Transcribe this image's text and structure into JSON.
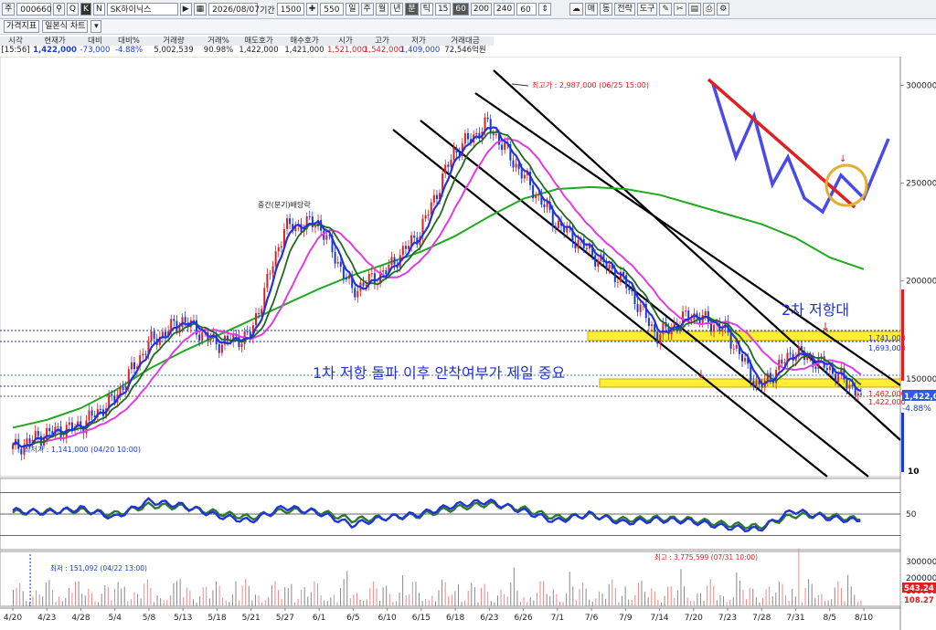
{
  "toolbar": {
    "type_label": "주",
    "code": "000660",
    "btn_q": "Q",
    "btn_k": "K",
    "btn_n": "N",
    "stock_name": "SK하이닉스",
    "date": "2026/08/07",
    "period_label": "기간",
    "period_value": "1500",
    "zoom_value": "550",
    "units": [
      "일",
      "주",
      "월",
      "년",
      "분",
      "틱"
    ],
    "minutes": [
      "15",
      "60",
      "200",
      "240",
      "60"
    ],
    "right_buttons": [
      "매",
      "동",
      "전략",
      "도구"
    ]
  },
  "subtoolbar": {
    "indicator_label": "가격지표",
    "chart_label": "일본식 차트"
  },
  "quote": {
    "headers": [
      "시각",
      "현재가",
      "대비",
      "대비%",
      "거래량",
      "거래%",
      "매도호가",
      "매수호가",
      "시가",
      "고가",
      "저가",
      "거래대금"
    ],
    "values": [
      "[15:56]",
      "1,422,000",
      "-73,000",
      "-4.88%",
      "5,002,539",
      "90.98%",
      "1,422,000",
      "1,421,000",
      "1,521,000",
      "1,542,000",
      "1,409,000",
      "72,546억원"
    ]
  },
  "colors": {
    "up": "#e02020",
    "down": "#1a3ad8",
    "ma_long": "#1faa1f",
    "ma_mid": "#e23be2",
    "highlight": "#ffee33"
  },
  "chart_data": [
    {
      "type": "line",
      "name_hint": "price-candlestick",
      "x": [
        "4/20",
        "4/23",
        "4/28",
        "5/4",
        "5/8",
        "5/13",
        "5/18",
        "5/21",
        "5/27",
        "6/1",
        "6/5",
        "6/10",
        "6/15",
        "6/18",
        "6/23",
        "6/26",
        "7/1",
        "7/6",
        "7/9",
        "7/14",
        "7/20",
        "7/23",
        "7/28",
        "7/31",
        "8/5",
        "8/10"
      ],
      "close": [
        1141000,
        1220000,
        1260000,
        1400000,
        1680000,
        1800000,
        1680000,
        1720000,
        2270000,
        2300000,
        1950000,
        2050000,
        2250000,
        2660000,
        2800000,
        2550000,
        2300000,
        2150000,
        2000000,
        1720000,
        1830000,
        1750000,
        1450000,
        1640000,
        1560000,
        1422000
      ],
      "ylim": [
        1000000,
        3100000
      ],
      "yticks": [
        "300000",
        "250000",
        "200000",
        "150000"
      ],
      "annotations": {
        "high": "최고가 : 2,987,000 (06/25 15:00)",
        "low": "최저가 : 1,141,000 (04/20 10:00)",
        "event": "중간(분기)배당락",
        "resist1": "1차 저항 돌파 이후 안착여부가 제일 중요",
        "resist2": "2차 저항대",
        "level_1741": "1,741,000",
        "level_1693": "1,693,000",
        "level_1462": "1,462,000",
        "level_1422": "1,422,000",
        "last_price": "1,422,0",
        "last_pct": "-4.88%"
      },
      "series": [
        {
          "name": "MA-long",
          "values": [
            1250000,
            1290000,
            1350000,
            1440000,
            1550000,
            1640000,
            1720000,
            1800000,
            1880000,
            1960000,
            2030000,
            2090000,
            2150000,
            2230000,
            2330000,
            2420000,
            2470000,
            2480000,
            2470000,
            2440000,
            2390000,
            2340000,
            2290000,
            2220000,
            2120000,
            2060000
          ]
        }
      ]
    },
    {
      "type": "line",
      "name_hint": "oscillator",
      "yticks": [
        "50"
      ],
      "series": [
        {
          "name": "osc-fast",
          "values": [
            55,
            52,
            58,
            45,
            68,
            62,
            48,
            40,
            60,
            52,
            35,
            45,
            50,
            62,
            68,
            55,
            40,
            50,
            38,
            42,
            40,
            32,
            28,
            55,
            45,
            40
          ]
        },
        {
          "name": "osc-slow",
          "values": [
            52,
            54,
            55,
            50,
            62,
            60,
            52,
            45,
            55,
            54,
            42,
            45,
            48,
            58,
            64,
            58,
            45,
            48,
            42,
            44,
            42,
            36,
            32,
            48,
            48,
            42
          ]
        }
      ]
    },
    {
      "type": "bar",
      "name_hint": "volume",
      "yticks": [
        "300000",
        "200000",
        "100000"
      ],
      "annotations": {
        "vol_high": "최고 : 3,775,599 (07/31 10:00)",
        "vol_low": "최저 : 151,092 (04/22 13:00)",
        "vol_last": "543.24",
        "vol_pct": "108.27"
      }
    }
  ],
  "side_label": "10"
}
